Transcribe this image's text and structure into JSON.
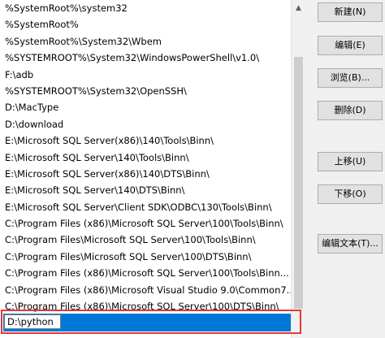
{
  "path_list": {
    "items": [
      "%SystemRoot%\\system32",
      "%SystemRoot%",
      "%SystemRoot%\\System32\\Wbem",
      "%SYSTEMROOT%\\System32\\WindowsPowerShell\\v1.0\\",
      "F:\\adb",
      "%SYSTEMROOT%\\System32\\OpenSSH\\",
      "D:\\MacType",
      "D:\\download",
      "E:\\Microsoft SQL Server(x86)\\140\\Tools\\Binn\\",
      "E:\\Microsoft SQL Server\\140\\Tools\\Binn\\",
      "E:\\Microsoft SQL Server(x86)\\140\\DTS\\Binn\\",
      "E:\\Microsoft SQL Server\\140\\DTS\\Binn\\",
      "E:\\Microsoft SQL Server\\Client SDK\\ODBC\\130\\Tools\\Binn\\",
      "C:\\Program Files (x86)\\Microsoft SQL Server\\100\\Tools\\Binn\\",
      "C:\\Program Files\\Microsoft SQL Server\\100\\Tools\\Binn\\",
      "C:\\Program Files\\Microsoft SQL Server\\100\\DTS\\Binn\\",
      "C:\\Program Files (x86)\\Microsoft SQL Server\\100\\Tools\\Binn...",
      "C:\\Program Files (x86)\\Microsoft Visual Studio 9.0\\Common7...",
      "C:\\Program Files (x86)\\Microsoft SQL Server\\100\\DTS\\Binn\\"
    ],
    "editing_value": "D:\\python"
  },
  "buttons": {
    "new": "新建(N)",
    "edit": "编辑(E)",
    "browse": "浏览(B)...",
    "delete": "删除(D)",
    "move_up": "上移(U)",
    "move_down": "下移(O)",
    "edit_text": "编辑文本(T)..."
  },
  "icons": {
    "scroll_up": "chevron-up-icon"
  },
  "colors": {
    "selection": "#0078d7",
    "highlight_border": "#e03a3a"
  }
}
